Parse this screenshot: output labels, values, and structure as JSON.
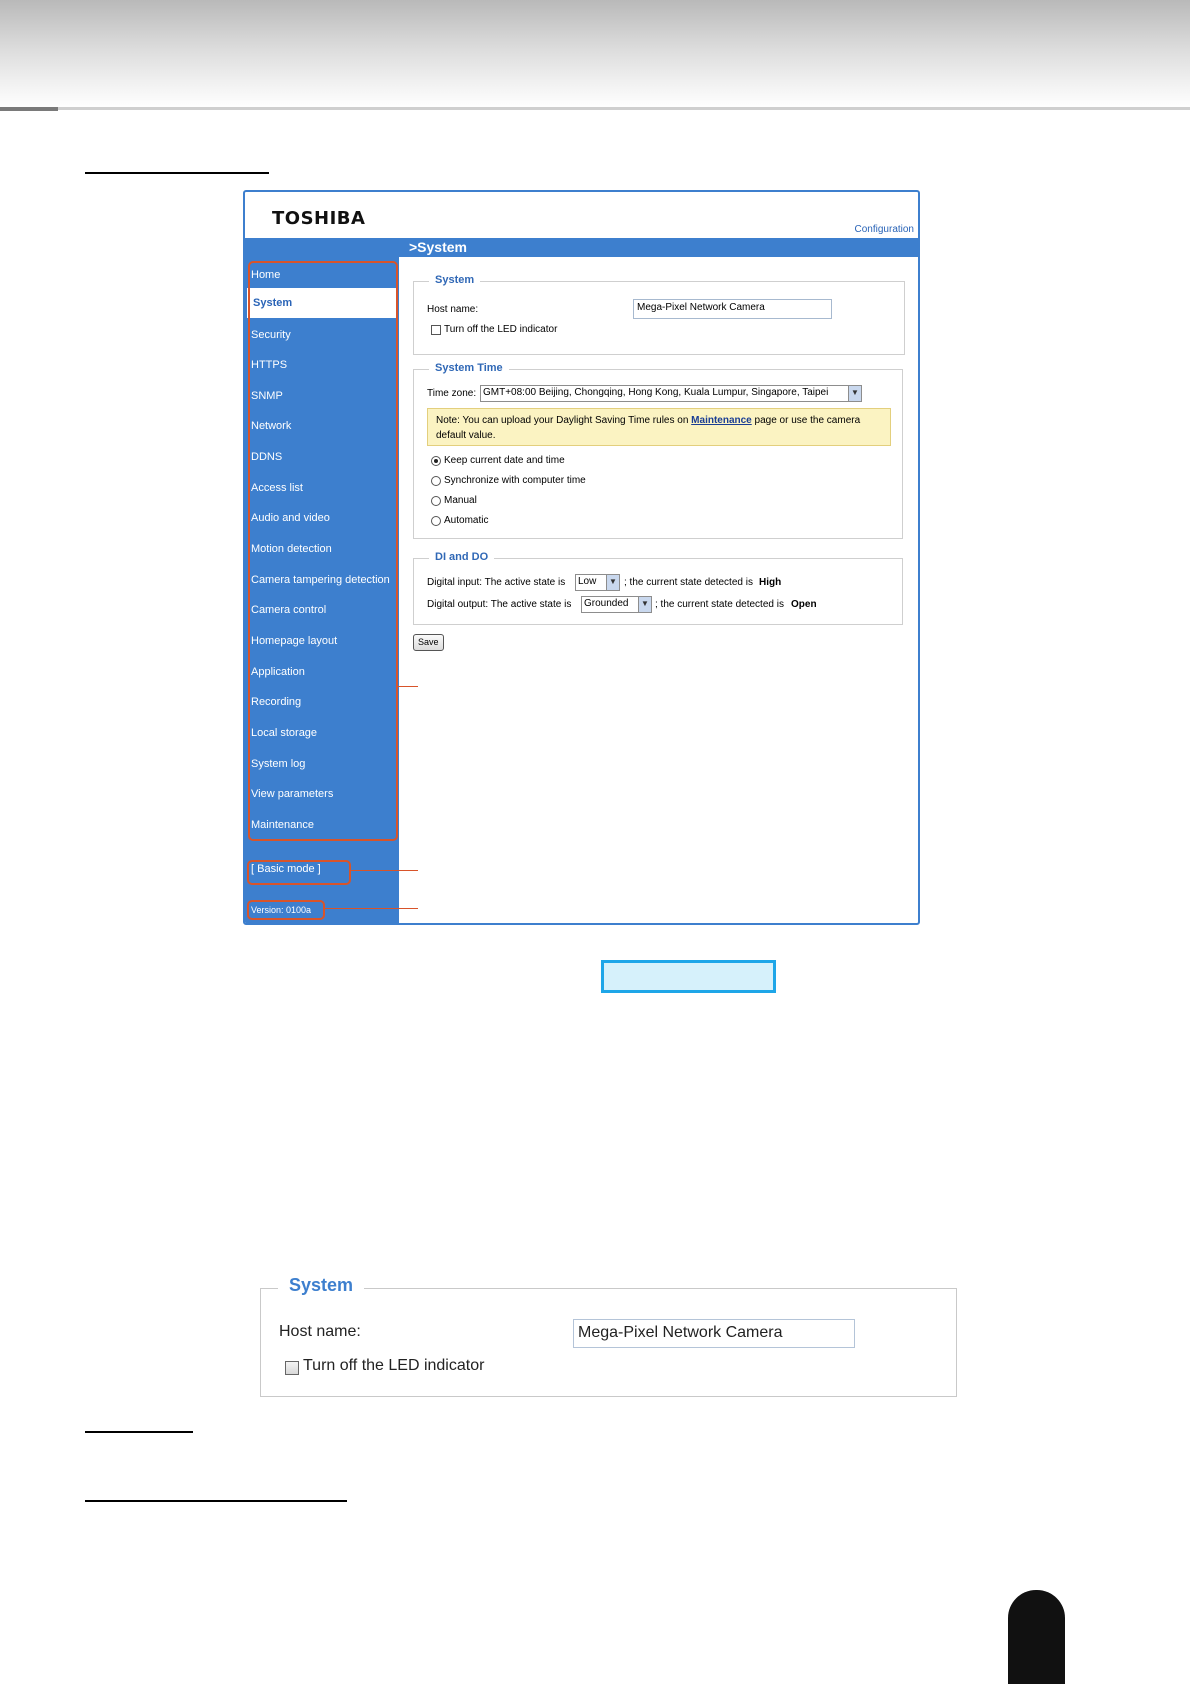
{
  "brand": {
    "logo": "TOSHIBA",
    "config_link": "Configuration"
  },
  "header": {
    "title": ">System"
  },
  "sidebar": {
    "items": [
      {
        "label": "Home"
      },
      {
        "label": "System"
      },
      {
        "label": "Security"
      },
      {
        "label": "HTTPS"
      },
      {
        "label": "SNMP"
      },
      {
        "label": "Network"
      },
      {
        "label": "DDNS"
      },
      {
        "label": "Access list"
      },
      {
        "label": "Audio and video"
      },
      {
        "label": "Motion detection"
      },
      {
        "label": "Camera tampering detection"
      },
      {
        "label": "Camera control"
      },
      {
        "label": "Homepage layout"
      },
      {
        "label": "Application"
      },
      {
        "label": "Recording"
      },
      {
        "label": "Local storage"
      },
      {
        "label": "System log"
      },
      {
        "label": "View parameters"
      },
      {
        "label": "Maintenance"
      }
    ],
    "selected": "System",
    "basic_mode": "[ Basic mode ]",
    "version": "Version: 0100a"
  },
  "system": {
    "legend": "System",
    "host_label": "Host name:",
    "host_value": "Mega-Pixel Network Camera",
    "led_label": "Turn off the LED indicator",
    "led_checked": false
  },
  "system_time": {
    "legend": "System Time",
    "tz_label": "Time zone:",
    "tz_value": "GMT+08:00 Beijing, Chongqing, Hong Kong, Kuala Lumpur, Singapore, Taipei",
    "note_before": "Note: You can upload your Daylight Saving Time rules on",
    "note_link": "Maintenance",
    "note_after": "page or use the camera",
    "note_line2": "default value.",
    "options": [
      {
        "label": "Keep current date and time",
        "selected": true
      },
      {
        "label": "Synchronize with computer time",
        "selected": false
      },
      {
        "label": "Manual",
        "selected": false
      },
      {
        "label": "Automatic",
        "selected": false
      }
    ]
  },
  "dido": {
    "legend": "DI and DO",
    "di_label": "Digital input: The active state is",
    "di_value": "Low",
    "di_state_text": "; the current state detected is",
    "di_state": "High",
    "do_label": "Digital output: The active state is",
    "do_value": "Grounded",
    "do_state_text": "; the current state detected is",
    "do_state": "Open"
  },
  "save_label": "Save",
  "zoom_panel": {
    "legend": "System",
    "host_label": "Host name:",
    "host_value": "Mega-Pixel Network Camera",
    "led_label": "Turn off the LED indicator"
  },
  "colors": {
    "accent": "#3d7fce",
    "callout": "#d8542a",
    "highlight": "#1ea6e8"
  }
}
